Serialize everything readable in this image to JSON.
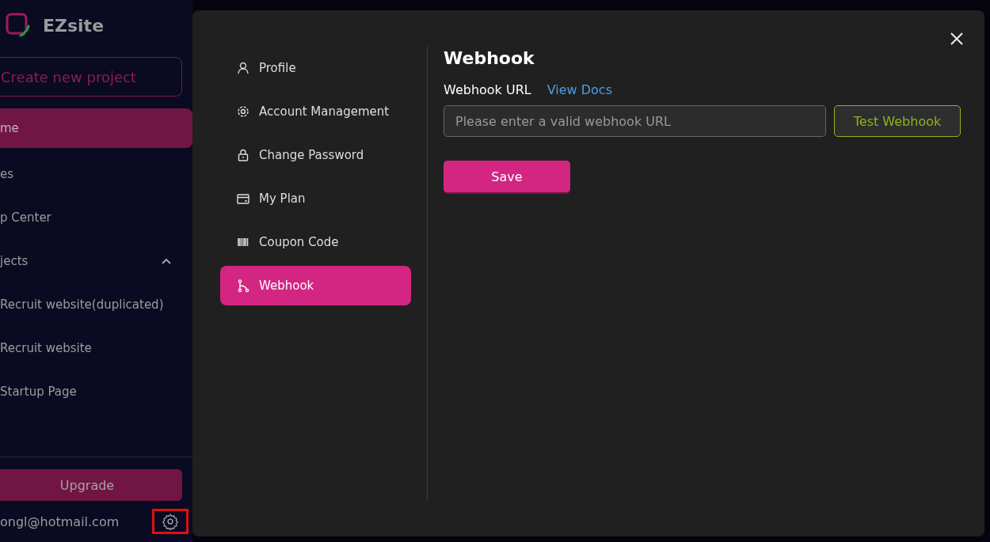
{
  "brand": {
    "name": "EZsite"
  },
  "sidebar": {
    "create_button": "Create new project",
    "items": [
      {
        "label": "me",
        "selected": true
      },
      {
        "label": "es",
        "selected": false
      },
      {
        "label": "p Center",
        "selected": false
      },
      {
        "label": "jects",
        "selected": false,
        "expanded": true,
        "children": [
          {
            "label": "Recruit website(duplicated)",
            "selected": false
          },
          {
            "label": "Recruit website",
            "selected": false
          },
          {
            "label": "Startup Page",
            "selected": false
          }
        ]
      }
    ],
    "upgrade_button": "Upgrade",
    "email": "ongl@hotmail.com"
  },
  "dialog": {
    "menu": [
      {
        "label": "Profile",
        "selected": false
      },
      {
        "label": "Account Management",
        "selected": false
      },
      {
        "label": "Change Password",
        "selected": false
      },
      {
        "label": "My Plan",
        "selected": false
      },
      {
        "label": "Coupon Code",
        "selected": false
      },
      {
        "label": "Webhook",
        "selected": true
      }
    ],
    "title": "Webhook",
    "field_label": "Webhook URL",
    "docs_link": "View Docs",
    "url_field": {
      "placeholder": "Please enter a valid webhook URL"
    },
    "test_button": "Test Webhook",
    "save_button": "Save"
  }
}
